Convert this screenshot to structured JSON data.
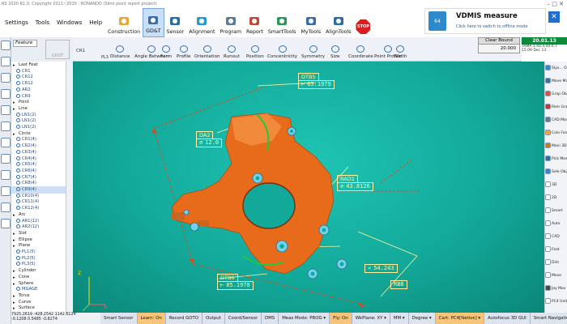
{
  "window": {
    "title": "RS 2020 R1.0, Copyright 2011~2020 : RONANDO (Slimi point report project)",
    "controls": "–  □  ✕"
  },
  "menu": [
    "Settings",
    "Tools",
    "Windows",
    "Help"
  ],
  "ribbon": [
    {
      "label": "Construction",
      "icon": "construction-icon"
    },
    {
      "label": "GD&T",
      "icon": "gdt-icon",
      "active": true
    },
    {
      "label": "Sensor",
      "icon": "sensor-icon"
    },
    {
      "label": "Alignment",
      "icon": "alignment-icon"
    },
    {
      "label": "Program",
      "icon": "program-icon"
    },
    {
      "label": "Report",
      "icon": "report-icon"
    },
    {
      "label": "SmartTools",
      "icon": "smarttools-icon"
    },
    {
      "label": "MyTools",
      "icon": "mytools-icon"
    },
    {
      "label": "AlignTools",
      "icon": "aligntools-icon"
    },
    {
      "label": "STOP",
      "icon": "stop-icon"
    }
  ],
  "vdmis": {
    "title": "VDMIS measure",
    "subtitle": "Click here to switch to offline mode",
    "badge": "64",
    "close": "✕"
  },
  "gdt_toolbar": {
    "cr1": "CR1",
    "pl3": "PL3",
    "buttons": [
      "Distance",
      "Angle Between",
      "Form",
      "Profile",
      "Orientation",
      "Runout",
      "Position",
      "Concentricity",
      "Symmetry",
      "Size",
      "Coordinate",
      "Point Profile",
      "Width"
    ]
  },
  "clear_bound": {
    "title": "Clear Bound",
    "value": "20.000"
  },
  "coords_panel": {
    "big": "20.01.13",
    "line1": "TAMA 1.40.4.40.0.7",
    "line2": "15.09 Dec 13"
  },
  "left_tabs": {
    "feature": "Feature",
    "gdot": "GDOT"
  },
  "tree": [
    {
      "label": "Last Feat",
      "cat": true
    },
    {
      "label": "CR1"
    },
    {
      "label": "CR12"
    },
    {
      "label": "CR12"
    },
    {
      "label": "AR2"
    },
    {
      "label": "CR9"
    },
    {
      "label": "Point",
      "cat": true
    },
    {
      "label": "Line",
      "cat": true
    },
    {
      "label": "LN1(2)"
    },
    {
      "label": "LN1(2)"
    },
    {
      "label": "LN1(2)"
    },
    {
      "label": "Circle",
      "cat": true
    },
    {
      "label": "CR1(4)"
    },
    {
      "label": "CR2(4)"
    },
    {
      "label": "CR3(4)"
    },
    {
      "label": "CR4(4)"
    },
    {
      "label": "CR5(4)"
    },
    {
      "label": "CR6(4)"
    },
    {
      "label": "CR7(4)"
    },
    {
      "label": "CR8(4)"
    },
    {
      "label": "CR9(4)",
      "sel": true
    },
    {
      "label": "CR10(4)"
    },
    {
      "label": "CR11(4)"
    },
    {
      "label": "CR12(4)"
    },
    {
      "label": "Arc",
      "cat": true
    },
    {
      "label": "AR1(12)"
    },
    {
      "label": "AR2(12)"
    },
    {
      "label": "Slot",
      "cat": true
    },
    {
      "label": "Ellipse",
      "cat": true
    },
    {
      "label": "Plane",
      "cat": true
    },
    {
      "label": "PL1(5)"
    },
    {
      "label": "PL2(5)"
    },
    {
      "label": "PL3(5)"
    },
    {
      "label": "Cylinder",
      "cat": true
    },
    {
      "label": "Cone",
      "cat": true
    },
    {
      "label": "Sphere",
      "cat": true
    },
    {
      "label": "MGAGE"
    },
    {
      "label": "Torus",
      "cat": true
    },
    {
      "label": "Curve",
      "cat": true
    },
    {
      "label": "Surface",
      "cat": true
    }
  ],
  "viewport": {
    "dims": [
      {
        "name": "DTB5",
        "value": "65.1979",
        "sym": "⊢"
      },
      {
        "name": "DA2",
        "value": "12.0",
        "sym": "⌀"
      },
      {
        "name": "RAD1",
        "value": "43.8126",
        "sym": "⊘"
      },
      {
        "name": "DTB6",
        "value": "85.1978",
        "sym": "⊢"
      },
      {
        "name": "",
        "value": "54.243",
        "sym": "∠"
      },
      {
        "name": "",
        "value": "RB8",
        "sym": ""
      }
    ],
    "axis_z": "Z",
    "axis_x": "X"
  },
  "right_panel": [
    {
      "label": "Slyx... Obje",
      "icon": "objects-icon",
      "color": "#2a8ad6"
    },
    {
      "label": "Move Mach",
      "icon": "move-icon",
      "color": "#3a6ea5"
    },
    {
      "label": "Grap Objec",
      "icon": "graph-icon",
      "color": "#e04e3c"
    },
    {
      "label": "Rem Grap",
      "icon": "remove-icon",
      "color": "#c0392b"
    },
    {
      "label": "CAD Mod",
      "icon": "cad-icon",
      "color": "#5a7a9a"
    },
    {
      "label": "Colo Form",
      "icon": "color-icon",
      "color": "#e9a93a"
    },
    {
      "label": "Mani 3D V",
      "icon": "3d-icon",
      "color": "#c07a2a"
    },
    {
      "label": "Pick Meas",
      "icon": "pick-icon",
      "color": "#2a6ea5"
    },
    {
      "label": "Sele Obje",
      "icon": "select-icon",
      "color": "#2a8ad6"
    },
    {
      "label": "3D",
      "icon": "3d-radio-icon",
      "color": "#fff"
    },
    {
      "label": "2D",
      "icon": "2d-radio-icon",
      "color": "#fff"
    },
    {
      "label": "Smart",
      "icon": "smart-icon",
      "color": "#fff"
    },
    {
      "label": "Auto",
      "icon": "auto-select-icon",
      "color": "#fff"
    },
    {
      "label": "CAD",
      "icon": "cad-check-icon",
      "color": "#fff"
    },
    {
      "label": "Feat",
      "icon": "feat-check-icon",
      "color": "#fff"
    },
    {
      "label": "Dim",
      "icon": "dim-check-icon",
      "color": "#fff"
    },
    {
      "label": "Move",
      "icon": "move-check-icon",
      "color": "#fff"
    },
    {
      "label": "Joy Mov",
      "icon": "joystick-icon",
      "color": "#4a4a4a"
    },
    {
      "label": "PC4 Unit:MM",
      "icon": "pc-icon",
      "color": "#fff"
    }
  ],
  "coord_readout": [
    {
      "x": "7925.2619",
      "y": "-428.2542",
      "z": "1142.6124"
    },
    {
      "x": "-0.1208",
      "y": "0.5485",
      "z": "-0.8274"
    }
  ],
  "status": [
    {
      "label": "Smart Sensor"
    },
    {
      "label": "Learn: On",
      "hi": true
    },
    {
      "label": "Record GOTO"
    },
    {
      "label": "Output"
    },
    {
      "label": "Coord/Sensor"
    },
    {
      "label": "DMS"
    },
    {
      "label": "Meas Mode: PROG ▾"
    },
    {
      "label": "Fly: On",
      "hi": true
    },
    {
      "label": "WkPlane: XY ▾"
    },
    {
      "label": "MM ▾"
    },
    {
      "label": "Degree ▾"
    },
    {
      "label": "Cart: PC4[Native] ▾",
      "hi": true
    },
    {
      "label": "Autofocus 3D GUI"
    },
    {
      "label": "Smart Navigation"
    }
  ],
  "colors": {
    "part": "#e86b1c",
    "dim_line": "#fff7a0",
    "arrow": "#d94a1e",
    "viewport": "#13a99a",
    "status_hi": "#f6c57a"
  }
}
